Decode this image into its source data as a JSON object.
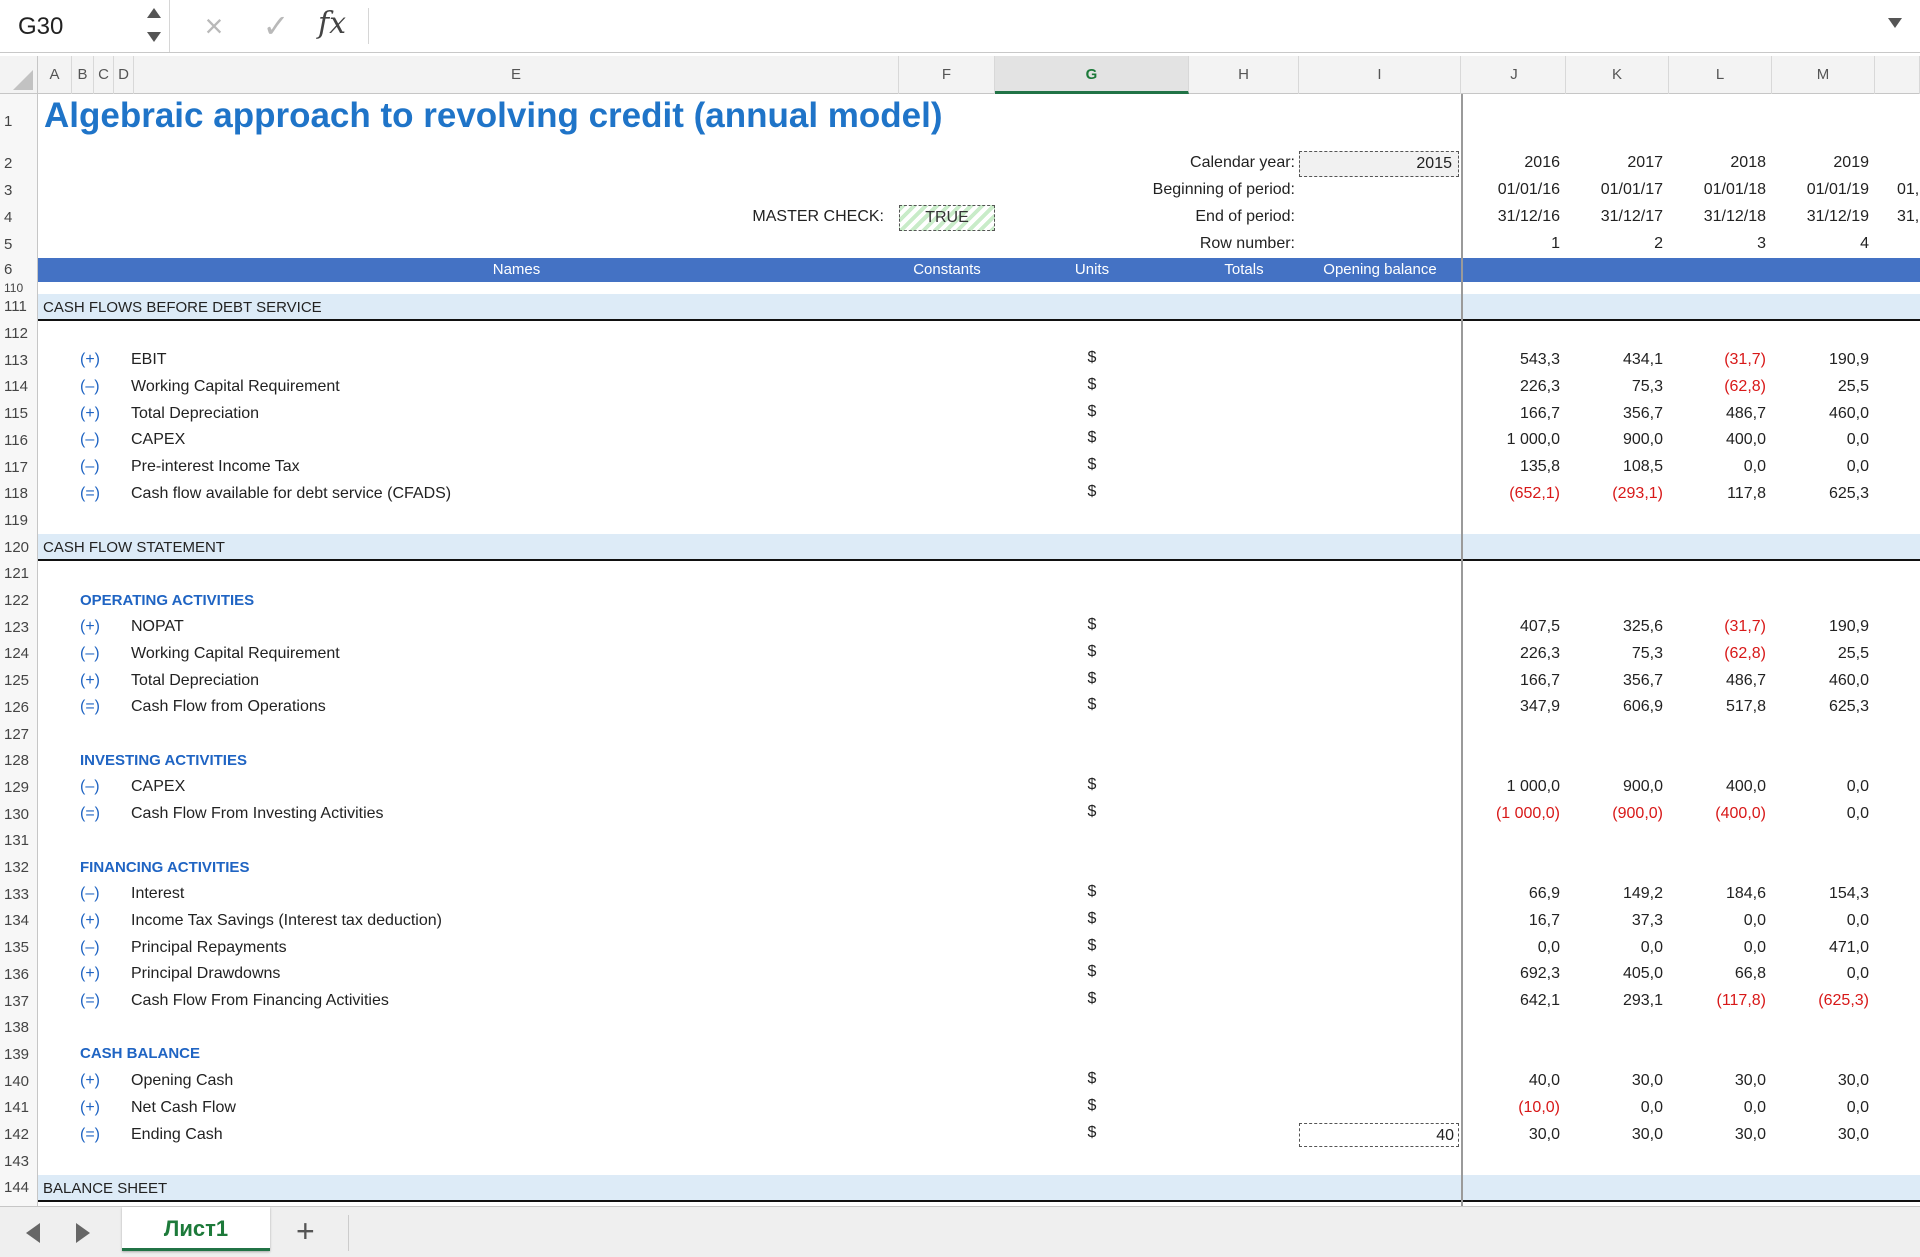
{
  "formula_bar": {
    "cell_ref": "G30",
    "cancel_icon": "×",
    "enter_icon": "✓",
    "fx_label": "fx",
    "formula": ""
  },
  "columns": [
    "A",
    "B",
    "C",
    "D",
    "E",
    "F",
    "G",
    "H",
    "I",
    "J",
    "K",
    "L",
    "M"
  ],
  "selected_column": "G",
  "title": "Algebraic approach to revolving credit (annual model)",
  "top_labels": {
    "calendar_year": "Calendar year:",
    "beginning": "Beginning of period:",
    "end": "End of period:",
    "row_number": "Row number:",
    "master_check": "MASTER CHECK:",
    "master_check_value": "TRUE",
    "calendar_year_value": "2015"
  },
  "periods": {
    "years": [
      "2016",
      "2017",
      "2018",
      "2019"
    ],
    "begin": [
      "01/01/16",
      "01/01/17",
      "01/01/18",
      "01/01/19",
      "01,"
    ],
    "end": [
      "31/12/16",
      "31/12/17",
      "31/12/18",
      "31/12/19",
      "31,"
    ],
    "row_numbers": [
      "1",
      "2",
      "3",
      "4"
    ]
  },
  "header_band": {
    "names": "Names",
    "constants": "Constants",
    "units": "Units",
    "totals": "Totals",
    "opening": "Opening balance"
  },
  "rows": [
    {
      "n": "1"
    },
    {
      "n": "2"
    },
    {
      "n": "3"
    },
    {
      "n": "4"
    },
    {
      "n": "5"
    },
    {
      "n": "6"
    },
    {
      "n": "110"
    },
    {
      "n": "111",
      "band": "CASH FLOWS BEFORE DEBT SERVICE"
    },
    {
      "n": "112"
    },
    {
      "n": "113",
      "sign": "(+)",
      "name": "EBIT",
      "unit": "$",
      "vals": [
        "543,3",
        "434,1",
        "(31,7)",
        "190,9"
      ]
    },
    {
      "n": "114",
      "sign": "(–)",
      "name": "Working Capital Requirement",
      "unit": "$",
      "vals": [
        "226,3",
        "75,3",
        "(62,8)",
        "25,5"
      ]
    },
    {
      "n": "115",
      "sign": "(+)",
      "name": "Total Depreciation",
      "unit": "$",
      "vals": [
        "166,7",
        "356,7",
        "486,7",
        "460,0"
      ]
    },
    {
      "n": "116",
      "sign": "(–)",
      "name": "CAPEX",
      "unit": "$",
      "vals": [
        "1 000,0",
        "900,0",
        "400,0",
        "0,0"
      ]
    },
    {
      "n": "117",
      "sign": "(–)",
      "name": "Pre-interest Income Tax",
      "unit": "$",
      "vals": [
        "135,8",
        "108,5",
        "0,0",
        "0,0"
      ]
    },
    {
      "n": "118",
      "sign": "(=)",
      "name": "Cash flow available for debt service (CFADS)",
      "unit": "$",
      "vals": [
        "(652,1)",
        "(293,1)",
        "117,8",
        "625,3"
      ]
    },
    {
      "n": "119"
    },
    {
      "n": "120",
      "band": "CASH FLOW STATEMENT"
    },
    {
      "n": "121"
    },
    {
      "n": "122",
      "section": "OPERATING ACTIVITIES"
    },
    {
      "n": "123",
      "sign": "(+)",
      "name": "NOPAT",
      "unit": "$",
      "vals": [
        "407,5",
        "325,6",
        "(31,7)",
        "190,9"
      ]
    },
    {
      "n": "124",
      "sign": "(–)",
      "name": "Working Capital Requirement",
      "unit": "$",
      "vals": [
        "226,3",
        "75,3",
        "(62,8)",
        "25,5"
      ]
    },
    {
      "n": "125",
      "sign": "(+)",
      "name": "Total Depreciation",
      "unit": "$",
      "vals": [
        "166,7",
        "356,7",
        "486,7",
        "460,0"
      ]
    },
    {
      "n": "126",
      "sign": "(=)",
      "name": "Cash Flow from Operations",
      "unit": "$",
      "vals": [
        "347,9",
        "606,9",
        "517,8",
        "625,3"
      ]
    },
    {
      "n": "127"
    },
    {
      "n": "128",
      "section": "INVESTING ACTIVITIES"
    },
    {
      "n": "129",
      "sign": "(–)",
      "name": "CAPEX",
      "unit": "$",
      "vals": [
        "1 000,0",
        "900,0",
        "400,0",
        "0,0"
      ]
    },
    {
      "n": "130",
      "sign": "(=)",
      "name": "Cash Flow From Investing Activities",
      "unit": "$",
      "vals": [
        "(1 000,0)",
        "(900,0)",
        "(400,0)",
        "0,0"
      ]
    },
    {
      "n": "131"
    },
    {
      "n": "132",
      "section": "FINANCING ACTIVITIES"
    },
    {
      "n": "133",
      "sign": "(–)",
      "name": "Interest",
      "unit": "$",
      "vals": [
        "66,9",
        "149,2",
        "184,6",
        "154,3"
      ]
    },
    {
      "n": "134",
      "sign": "(+)",
      "name": "Income Tax Savings (Interest tax deduction)",
      "unit": "$",
      "vals": [
        "16,7",
        "37,3",
        "0,0",
        "0,0"
      ]
    },
    {
      "n": "135",
      "sign": "(–)",
      "name": "Principal Repayments",
      "unit": "$",
      "vals": [
        "0,0",
        "0,0",
        "0,0",
        "471,0"
      ]
    },
    {
      "n": "136",
      "sign": "(+)",
      "name": "Principal Drawdowns",
      "unit": "$",
      "vals": [
        "692,3",
        "405,0",
        "66,8",
        "0,0"
      ]
    },
    {
      "n": "137",
      "sign": "(=)",
      "name": "Cash Flow From Financing Activities",
      "unit": "$",
      "vals": [
        "642,1",
        "293,1",
        "(117,8)",
        "(625,3)"
      ]
    },
    {
      "n": "138"
    },
    {
      "n": "139",
      "section": "CASH BALANCE"
    },
    {
      "n": "140",
      "sign": "(+)",
      "name": "Opening Cash",
      "unit": "$",
      "vals": [
        "40,0",
        "30,0",
        "30,0",
        "30,0"
      ]
    },
    {
      "n": "141",
      "sign": "(+)",
      "name": "Net Cash Flow",
      "unit": "$",
      "vals": [
        "(10,0)",
        "0,0",
        "0,0",
        "0,0"
      ]
    },
    {
      "n": "142",
      "sign": "(=)",
      "name": "Ending Cash",
      "unit": "$",
      "opening": "40",
      "vals": [
        "30,0",
        "30,0",
        "30,0",
        "30,0"
      ]
    },
    {
      "n": "143"
    },
    {
      "n": "144",
      "band": "BALANCE SHEET"
    }
  ],
  "sheet_tabs": {
    "active": "Лист1",
    "add": "+"
  },
  "colors": {
    "accent": "#217346",
    "title": "#1f74c8",
    "header_band": "#4472c4",
    "section_band": "#ddebf7",
    "negative": "#d81818"
  }
}
